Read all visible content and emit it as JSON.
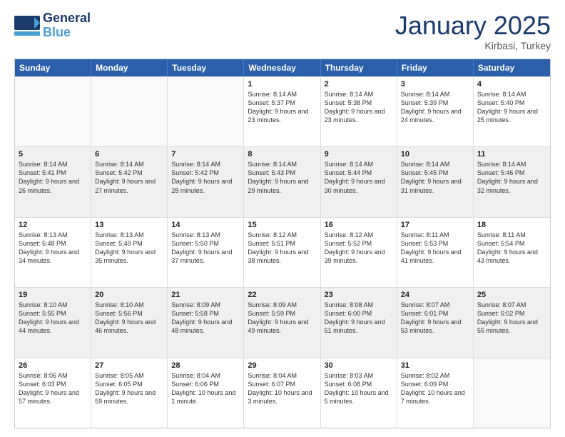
{
  "header": {
    "logo_general": "General",
    "logo_blue": "Blue",
    "month": "January 2025",
    "location": "Kirbasi, Turkey"
  },
  "weekdays": [
    "Sunday",
    "Monday",
    "Tuesday",
    "Wednesday",
    "Thursday",
    "Friday",
    "Saturday"
  ],
  "rows": [
    [
      {
        "day": "",
        "info": "",
        "empty": true
      },
      {
        "day": "",
        "info": "",
        "empty": true
      },
      {
        "day": "",
        "info": "",
        "empty": true
      },
      {
        "day": "1",
        "info": "Sunrise: 8:14 AM\nSunset: 5:37 PM\nDaylight: 9 hours and 23 minutes."
      },
      {
        "day": "2",
        "info": "Sunrise: 8:14 AM\nSunset: 5:38 PM\nDaylight: 9 hours and 23 minutes."
      },
      {
        "day": "3",
        "info": "Sunrise: 8:14 AM\nSunset: 5:39 PM\nDaylight: 9 hours and 24 minutes."
      },
      {
        "day": "4",
        "info": "Sunrise: 8:14 AM\nSunset: 5:40 PM\nDaylight: 9 hours and 25 minutes."
      }
    ],
    [
      {
        "day": "5",
        "info": "Sunrise: 8:14 AM\nSunset: 5:41 PM\nDaylight: 9 hours and 26 minutes."
      },
      {
        "day": "6",
        "info": "Sunrise: 8:14 AM\nSunset: 5:42 PM\nDaylight: 9 hours and 27 minutes."
      },
      {
        "day": "7",
        "info": "Sunrise: 8:14 AM\nSunset: 5:42 PM\nDaylight: 9 hours and 28 minutes."
      },
      {
        "day": "8",
        "info": "Sunrise: 8:14 AM\nSunset: 5:43 PM\nDaylight: 9 hours and 29 minutes."
      },
      {
        "day": "9",
        "info": "Sunrise: 8:14 AM\nSunset: 5:44 PM\nDaylight: 9 hours and 30 minutes."
      },
      {
        "day": "10",
        "info": "Sunrise: 8:14 AM\nSunset: 5:45 PM\nDaylight: 9 hours and 31 minutes."
      },
      {
        "day": "11",
        "info": "Sunrise: 8:14 AM\nSunset: 5:46 PM\nDaylight: 9 hours and 32 minutes."
      }
    ],
    [
      {
        "day": "12",
        "info": "Sunrise: 8:13 AM\nSunset: 5:48 PM\nDaylight: 9 hours and 34 minutes."
      },
      {
        "day": "13",
        "info": "Sunrise: 8:13 AM\nSunset: 5:49 PM\nDaylight: 9 hours and 35 minutes."
      },
      {
        "day": "14",
        "info": "Sunrise: 8:13 AM\nSunset: 5:50 PM\nDaylight: 9 hours and 37 minutes."
      },
      {
        "day": "15",
        "info": "Sunrise: 8:12 AM\nSunset: 5:51 PM\nDaylight: 9 hours and 38 minutes."
      },
      {
        "day": "16",
        "info": "Sunrise: 8:12 AM\nSunset: 5:52 PM\nDaylight: 9 hours and 39 minutes."
      },
      {
        "day": "17",
        "info": "Sunrise: 8:11 AM\nSunset: 5:53 PM\nDaylight: 9 hours and 41 minutes."
      },
      {
        "day": "18",
        "info": "Sunrise: 8:11 AM\nSunset: 5:54 PM\nDaylight: 9 hours and 43 minutes."
      }
    ],
    [
      {
        "day": "19",
        "info": "Sunrise: 8:10 AM\nSunset: 5:55 PM\nDaylight: 9 hours and 44 minutes."
      },
      {
        "day": "20",
        "info": "Sunrise: 8:10 AM\nSunset: 5:56 PM\nDaylight: 9 hours and 46 minutes."
      },
      {
        "day": "21",
        "info": "Sunrise: 8:09 AM\nSunset: 5:58 PM\nDaylight: 9 hours and 48 minutes."
      },
      {
        "day": "22",
        "info": "Sunrise: 8:09 AM\nSunset: 5:59 PM\nDaylight: 9 hours and 49 minutes."
      },
      {
        "day": "23",
        "info": "Sunrise: 8:08 AM\nSunset: 6:00 PM\nDaylight: 9 hours and 51 minutes."
      },
      {
        "day": "24",
        "info": "Sunrise: 8:07 AM\nSunset: 6:01 PM\nDaylight: 9 hours and 53 minutes."
      },
      {
        "day": "25",
        "info": "Sunrise: 8:07 AM\nSunset: 6:02 PM\nDaylight: 9 hours and 55 minutes."
      }
    ],
    [
      {
        "day": "26",
        "info": "Sunrise: 8:06 AM\nSunset: 6:03 PM\nDaylight: 9 hours and 57 minutes."
      },
      {
        "day": "27",
        "info": "Sunrise: 8:05 AM\nSunset: 6:05 PM\nDaylight: 9 hours and 59 minutes."
      },
      {
        "day": "28",
        "info": "Sunrise: 8:04 AM\nSunset: 6:06 PM\nDaylight: 10 hours and 1 minute."
      },
      {
        "day": "29",
        "info": "Sunrise: 8:04 AM\nSunset: 6:07 PM\nDaylight: 10 hours and 3 minutes."
      },
      {
        "day": "30",
        "info": "Sunrise: 8:03 AM\nSunset: 6:08 PM\nDaylight: 10 hours and 5 minutes."
      },
      {
        "day": "31",
        "info": "Sunrise: 8:02 AM\nSunset: 6:09 PM\nDaylight: 10 hours and 7 minutes."
      },
      {
        "day": "",
        "info": "",
        "empty": true
      }
    ]
  ]
}
